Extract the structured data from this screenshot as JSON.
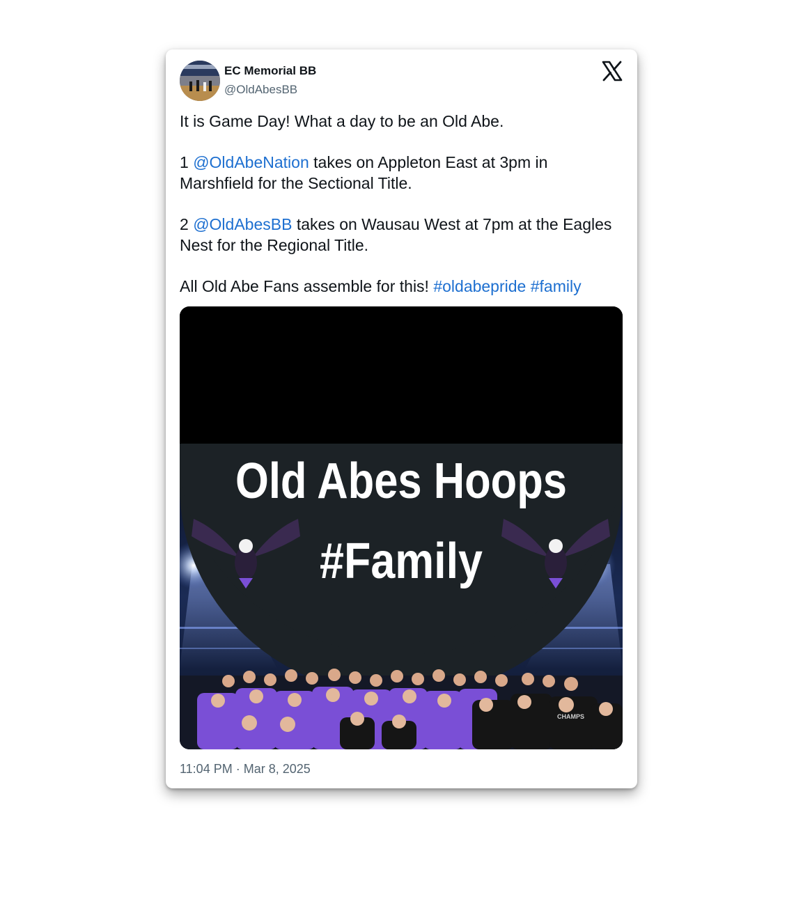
{
  "post": {
    "author": {
      "name": "EC Memorial BB",
      "handle": "@OldAbesBB"
    },
    "platform_icon": "x-logo-icon",
    "text": {
      "line1": "It is Game Day! What a day to be an Old Abe.",
      "p2_prefix": "1 ",
      "p2_mention": "@OldAbeNation",
      "p2_rest": " takes on Appleton East at 3pm in Marshfield for the Sectional Title.",
      "p3_prefix": "2 ",
      "p3_mention": "@OldAbesBB",
      "p3_rest": " takes on Wausau West at 7pm at the Eagles Nest for the Regional Title.",
      "p4_prefix": "All Old Abe Fans assemble for this! ",
      "hashtag1": "#oldabepride",
      "hashtag2": "#family"
    },
    "media": {
      "headline": "Old Abes Hoops",
      "subheadline": "#Family",
      "team_color": "#7a4fd6",
      "shirt_text": "CHAMPS"
    },
    "timestamp": "11:04 PM · Mar 8, 2025"
  },
  "colors": {
    "link": "#1d6fd0",
    "text": "#0f1419",
    "secondary": "#536471"
  }
}
